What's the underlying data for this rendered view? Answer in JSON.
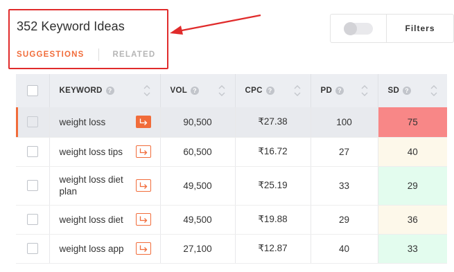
{
  "header": {
    "title": "352 Keyword Ideas",
    "tabs": [
      {
        "label": "SUGGESTIONS",
        "active": true
      },
      {
        "label": "RELATED",
        "active": false
      }
    ]
  },
  "toolbar": {
    "filters_label": "Filters",
    "toggle_on": false
  },
  "table": {
    "columns": [
      "KEYWORD",
      "VOL",
      "CPC",
      "PD",
      "SD"
    ],
    "help_glyph": "?",
    "rows": [
      {
        "keyword": "weight loss",
        "vol": "90,500",
        "cpc": "₹27.38",
        "pd": "100",
        "sd": "75",
        "sd_color": "#f88787",
        "active": true
      },
      {
        "keyword": "weight loss tips",
        "vol": "60,500",
        "cpc": "₹16.72",
        "pd": "27",
        "sd": "40",
        "sd_color": "#fdf8ea",
        "active": false
      },
      {
        "keyword": "weight loss diet plan",
        "vol": "49,500",
        "cpc": "₹25.19",
        "pd": "33",
        "sd": "29",
        "sd_color": "#e3fcee",
        "active": false
      },
      {
        "keyword": "weight loss diet",
        "vol": "49,500",
        "cpc": "₹19.88",
        "pd": "29",
        "sd": "36",
        "sd_color": "#fdf8ea",
        "active": false
      },
      {
        "keyword": "weight loss app",
        "vol": "27,100",
        "cpc": "₹12.87",
        "pd": "40",
        "sd": "33",
        "sd_color": "#e3fcee",
        "active": false
      }
    ]
  },
  "colors": {
    "accent": "#f16c3a",
    "annotation_red": "#e02b2b"
  }
}
